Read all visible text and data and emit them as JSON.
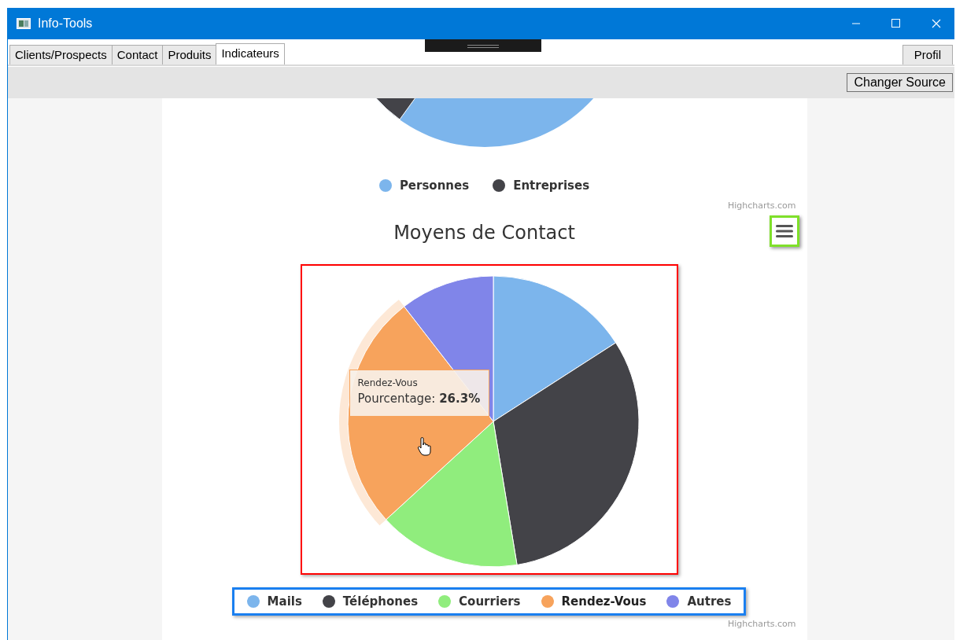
{
  "window": {
    "title": "Info-Tools"
  },
  "tabs": [
    {
      "label": "Clients/Prospects",
      "selected": false
    },
    {
      "label": "Contact",
      "selected": false
    },
    {
      "label": "Produits",
      "selected": false
    },
    {
      "label": "Indicateurs",
      "selected": true
    }
  ],
  "profile_button": "Profil",
  "toolbar": {
    "change_source_button": "Changer Source"
  },
  "charts": [
    {
      "legend": [
        {
          "label": "Personnes",
          "color": "#7cb5ec"
        },
        {
          "label": "Entreprises",
          "color": "#434348"
        }
      ],
      "credit": "Highcharts.com"
    },
    {
      "title": "Moyens de Contact",
      "legend": [
        {
          "label": "Mails",
          "color": "#7cb5ec",
          "hovered": false
        },
        {
          "label": "Téléphones",
          "color": "#434348",
          "hovered": false
        },
        {
          "label": "Courriers",
          "color": "#90ed7d",
          "hovered": false
        },
        {
          "label": "Rendez-Vous",
          "color": "#f7a35c",
          "hovered": true
        },
        {
          "label": "Autres",
          "color": "#8085e9",
          "hovered": false
        }
      ],
      "tooltip": {
        "series": "Rendez-Vous",
        "text": "Pourcentage: **26.3%**"
      },
      "credit": "Highcharts.com"
    }
  ]
}
